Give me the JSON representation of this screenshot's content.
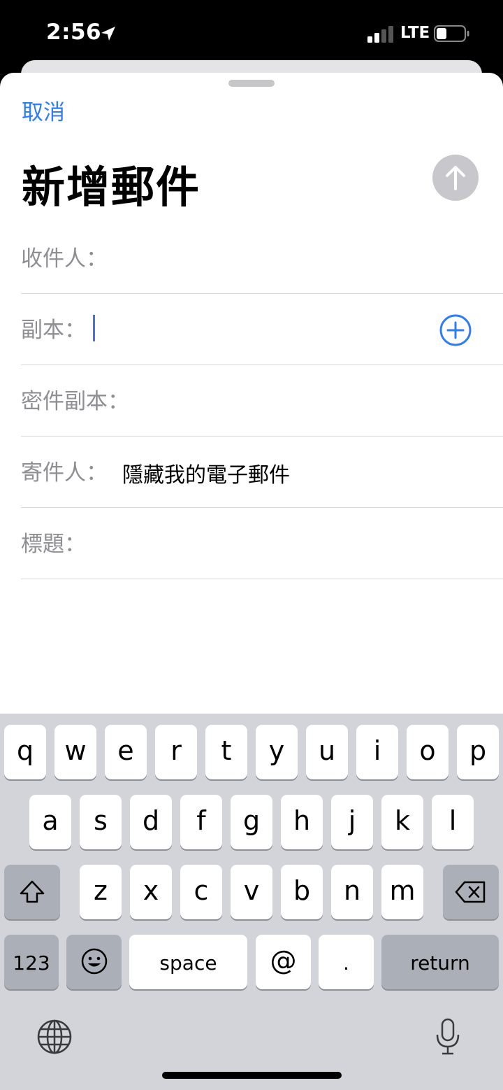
{
  "status_bar": {
    "time": "2:56",
    "network": "LTE"
  },
  "compose": {
    "cancel_label": "取消",
    "title": "新增郵件",
    "fields": {
      "to_label": "收件人：",
      "cc_label": "副本：",
      "bcc_label": "密件副本：",
      "from_label": "寄件人：",
      "from_value": "隱藏我的電子郵件",
      "subject_label": "標題："
    }
  },
  "keyboard": {
    "row1": [
      "q",
      "w",
      "e",
      "r",
      "t",
      "y",
      "u",
      "i",
      "o",
      "p"
    ],
    "row2": [
      "a",
      "s",
      "d",
      "f",
      "g",
      "h",
      "j",
      "k",
      "l"
    ],
    "row3": [
      "z",
      "x",
      "c",
      "v",
      "b",
      "n",
      "m"
    ],
    "numbers_label": "123",
    "space_label": "space",
    "at_label": "@",
    "dot_label": ".",
    "return_label": "return"
  },
  "colors": {
    "accent": "#2f7cf6",
    "send_disabled": "#c7c7cc",
    "keyboard_bg": "#d2d4da"
  }
}
